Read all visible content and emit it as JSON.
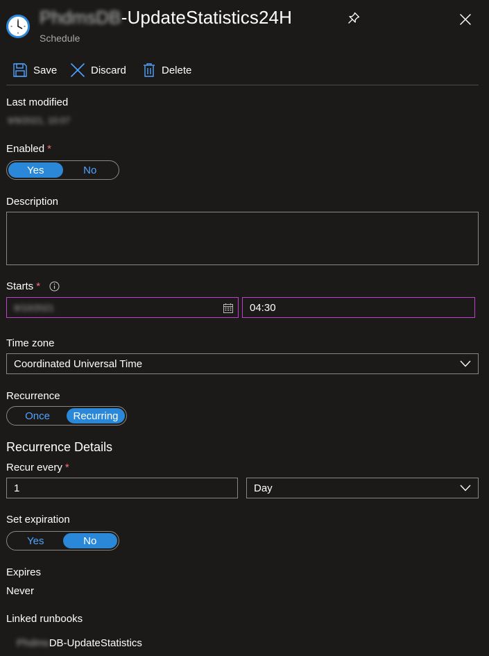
{
  "header": {
    "title_hidden": "PhdmsDB",
    "title_visible": "-UpdateStatistics24H",
    "subtitle": "Schedule"
  },
  "toolbar": {
    "save_label": "Save",
    "discard_label": "Discard",
    "delete_label": "Delete"
  },
  "last_modified": {
    "label": "Last modified",
    "value_redacted": "9/9/2021, 10:07"
  },
  "enabled": {
    "label": "Enabled",
    "required_mark": "*",
    "yes": "Yes",
    "no": "No",
    "selected": "Yes"
  },
  "description": {
    "label": "Description",
    "value": ""
  },
  "starts": {
    "label": "Starts",
    "required_mark": "*",
    "info_icon": "info-icon",
    "date_redacted": "9/10/2021",
    "time": "04:30"
  },
  "timezone": {
    "label": "Time zone",
    "value": "Coordinated Universal Time"
  },
  "recurrence": {
    "label": "Recurrence",
    "once": "Once",
    "recurring": "Recurring",
    "selected": "Recurring"
  },
  "recurrence_details": {
    "title": "Recurrence Details",
    "recur_every_label": "Recur every",
    "required_mark": "*",
    "interval": "1",
    "unit": "Day"
  },
  "set_expiration": {
    "label": "Set expiration",
    "yes": "Yes",
    "no": "No",
    "selected": "No"
  },
  "expires": {
    "label": "Expires",
    "value": "Never"
  },
  "linked_runbooks": {
    "label": "Linked runbooks",
    "item_hidden": "Phdms",
    "item_visible": "DB-UpdateStatistics"
  },
  "colors": {
    "background": "#1b1a19",
    "accent": "#2b88d8",
    "required": "#f1707b",
    "focus_border": "#c23fd1"
  }
}
